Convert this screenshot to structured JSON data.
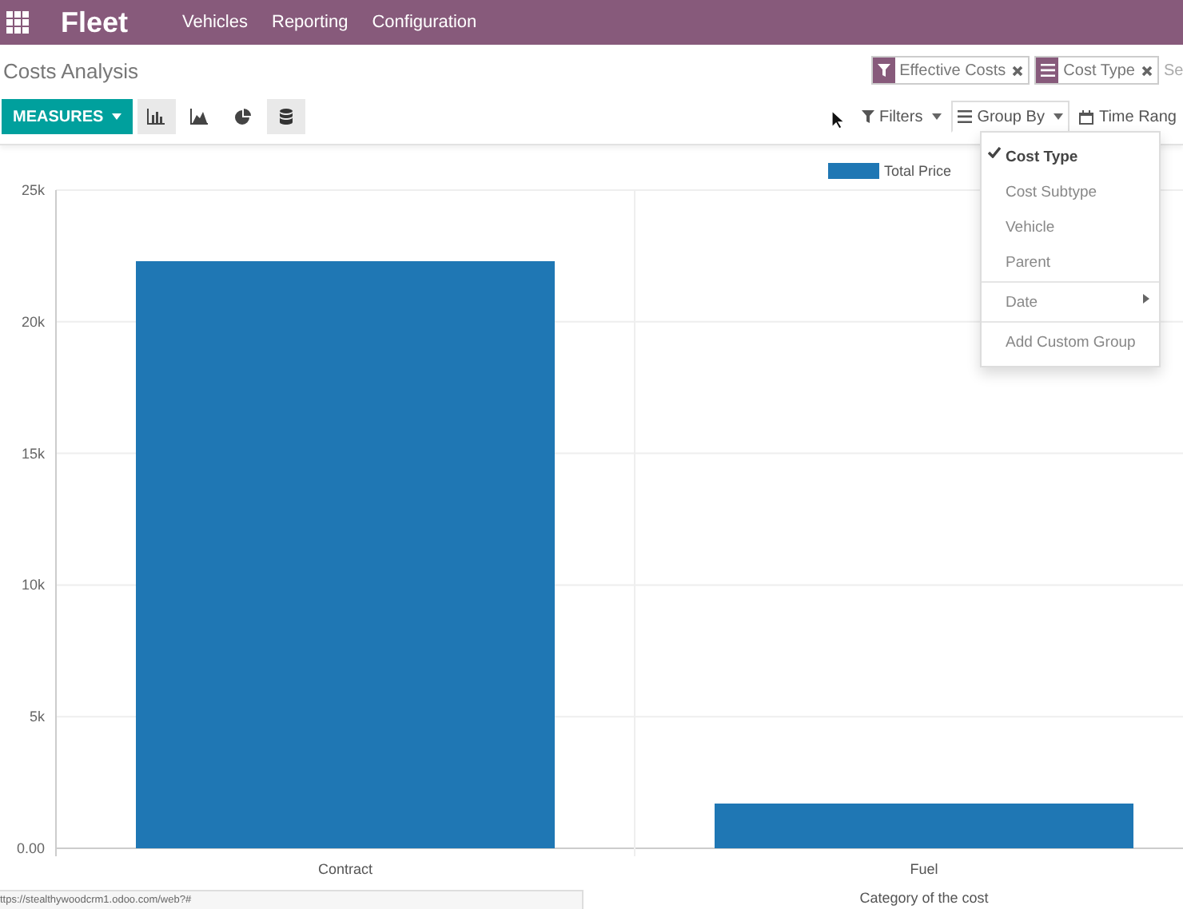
{
  "navbar": {
    "brand": "Fleet",
    "menu": [
      "Vehicles",
      "Reporting",
      "Configuration"
    ]
  },
  "control_panel": {
    "title": "Costs Analysis",
    "facets": [
      {
        "kind": "filter",
        "label": "Effective Costs"
      },
      {
        "kind": "groupby",
        "label": "Cost Type"
      }
    ],
    "search": {
      "placeholder": "Se"
    },
    "measures_button": "MEASURES",
    "view_buttons": [
      {
        "kind": "bar",
        "selected": true
      },
      {
        "kind": "line",
        "selected": false
      },
      {
        "kind": "pie",
        "selected": false
      },
      {
        "kind": "stack",
        "selected": true
      }
    ],
    "search_buttons": [
      {
        "kind": "filter",
        "label": "Filters",
        "expanded": false
      },
      {
        "kind": "groupby",
        "label": "Group By",
        "expanded": true
      },
      {
        "kind": "timerange",
        "label": "Time Rang",
        "expanded": false
      }
    ]
  },
  "group_by_menu": {
    "sections": [
      [
        {
          "kind": "option",
          "label": "Cost Type",
          "checked": true
        },
        {
          "kind": "option",
          "label": "Cost Subtype",
          "checked": false
        },
        {
          "kind": "option",
          "label": "Vehicle",
          "checked": false
        },
        {
          "kind": "option",
          "label": "Parent",
          "checked": false
        }
      ],
      [
        {
          "kind": "submenu",
          "label": "Date"
        }
      ],
      [
        {
          "kind": "action",
          "label": "Add Custom Group"
        }
      ]
    ]
  },
  "graph": {
    "chart_data": {
      "type": "bar",
      "xlabel": "Category of the cost",
      "categories": [
        "Contract",
        "Fuel"
      ],
      "series": [
        {
          "name": "Total Price",
          "color": "#1f77b4",
          "values": [
            22300,
            1700
          ]
        }
      ],
      "ylim": [
        0,
        25000
      ],
      "grid": true,
      "yticks": [
        {
          "value": 0,
          "label": "0.00"
        },
        {
          "value": 5000,
          "label": "5k"
        },
        {
          "value": 10000,
          "label": "10k"
        },
        {
          "value": 15000,
          "label": "15k"
        },
        {
          "value": 20000,
          "label": "20k"
        },
        {
          "value": 25000,
          "label": "25k"
        }
      ]
    }
  },
  "status_url": "ttps://stealthywoodcrm1.odoo.com/web?#"
}
